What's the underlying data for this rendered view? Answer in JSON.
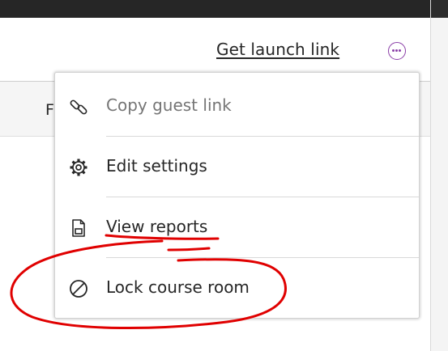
{
  "header": {
    "launch_link_label": "Get launch link",
    "more_icon": "more-options-icon",
    "accent_color": "#8a3ea7"
  },
  "table": {
    "partial_column_header": "F"
  },
  "menu": {
    "items": [
      {
        "label": "Copy guest link",
        "icon": "link-icon",
        "disabled": true
      },
      {
        "label": "Edit settings",
        "icon": "gear-icon",
        "disabled": false
      },
      {
        "label": "View reports",
        "icon": "report-icon",
        "disabled": false
      },
      {
        "label": "Lock course room",
        "icon": "lock-prohibited-icon",
        "disabled": false
      }
    ]
  },
  "annotation": {
    "color": "#e00000",
    "marks": [
      "underline-view-reports",
      "circle-lock-course-room"
    ]
  }
}
